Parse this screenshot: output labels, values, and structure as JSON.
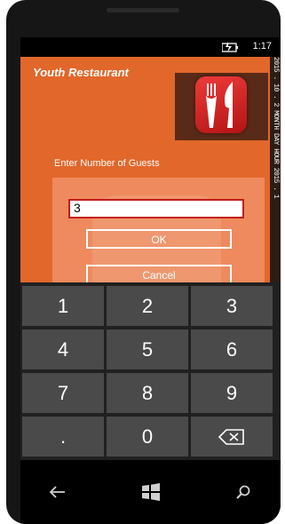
{
  "status": {
    "time": "1:17"
  },
  "app": {
    "title": "Youth  Restaurant",
    "prompt": "Enter Number of Guests",
    "input_value": "3",
    "ok_label": "OK",
    "cancel_label": "Cancel",
    "side_text": "2015 . 10 . 2 MONTH DAY HOUR 2015 . 1"
  },
  "keypad": {
    "keys": [
      "1",
      "2",
      "3",
      "4",
      "5",
      "6",
      "7",
      "8",
      "9",
      ".",
      "0"
    ],
    "backspace_icon": "backspace-icon"
  },
  "nav": {
    "back_icon": "back-arrow-icon",
    "home_icon": "windows-logo-icon",
    "search_icon": "search-icon"
  },
  "colors": {
    "app_bg": "#e2672b",
    "accent": "#c51c1c",
    "key_bg": "#4a4a4a"
  }
}
